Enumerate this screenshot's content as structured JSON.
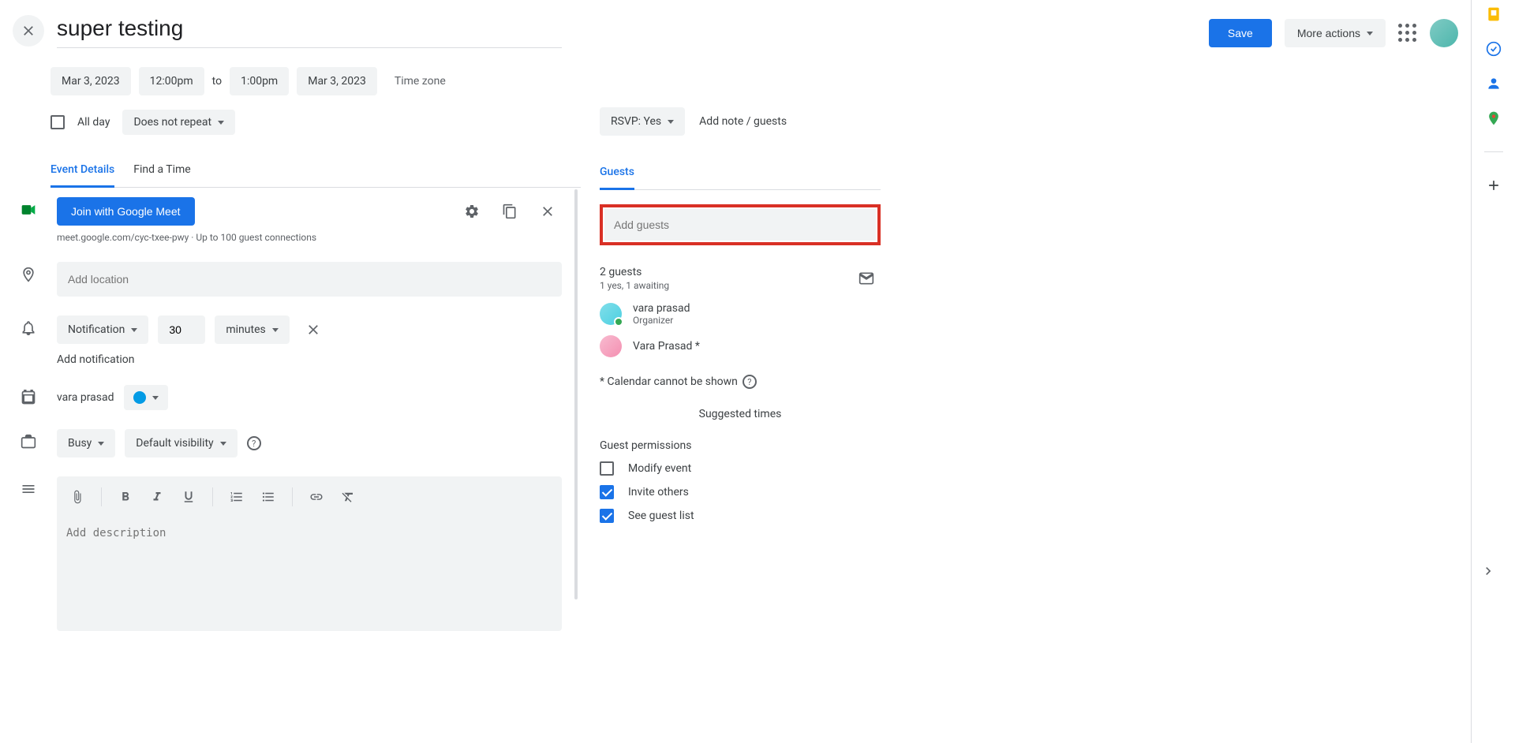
{
  "header": {
    "title": "super testing",
    "save": "Save",
    "more_actions": "More actions"
  },
  "date": {
    "start_date": "Mar 3, 2023",
    "start_time": "12:00pm",
    "to": "to",
    "end_time": "1:00pm",
    "end_date": "Mar 3, 2023",
    "timezone": "Time zone"
  },
  "allday": {
    "label": "All day",
    "repeat": "Does not repeat"
  },
  "tabs": {
    "details": "Event Details",
    "find_time": "Find a Time"
  },
  "meet": {
    "button": "Join with Google Meet",
    "link_line": "meet.google.com/cyc-txee-pwy · Up to 100 guest connections"
  },
  "location": {
    "placeholder": "Add location"
  },
  "notification": {
    "type": "Notification",
    "value": "30",
    "unit": "minutes",
    "add": "Add notification"
  },
  "calendar": {
    "owner": "vara prasad"
  },
  "visibility": {
    "busy": "Busy",
    "default": "Default visibility"
  },
  "description": {
    "placeholder": "Add description"
  },
  "rsvp": {
    "label": "RSVP: Yes",
    "add_note": "Add note / guests"
  },
  "guests": {
    "tab": "Guests",
    "add_placeholder": "Add guests",
    "count": "2 guests",
    "count_sub": "1 yes, 1 awaiting",
    "g1_name": "vara prasad",
    "g1_role": "Organizer",
    "g2_name": "Vara Prasad *",
    "footnote": "* Calendar cannot be shown",
    "suggested": "Suggested times"
  },
  "permissions": {
    "title": "Guest permissions",
    "modify": "Modify event",
    "invite": "Invite others",
    "see_list": "See guest list"
  }
}
